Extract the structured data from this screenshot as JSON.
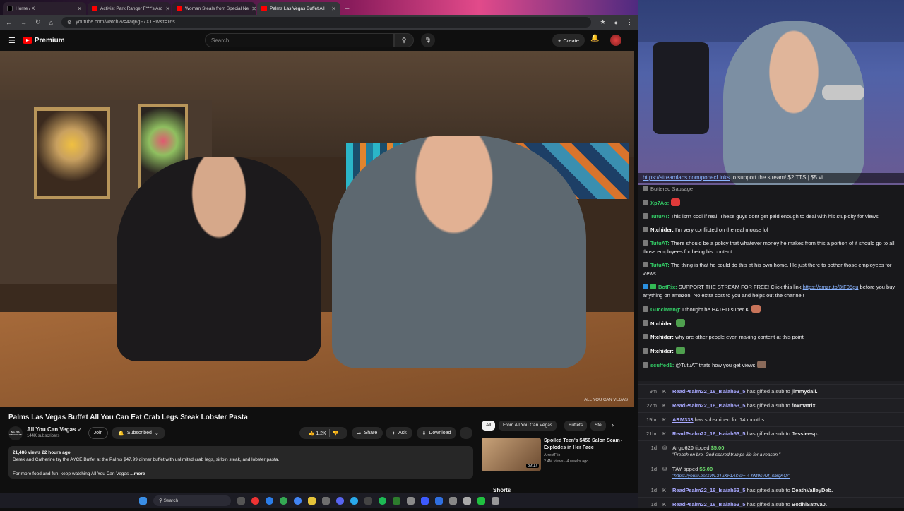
{
  "browser": {
    "tabs": [
      {
        "label": "Home / X",
        "active": false,
        "color": "#000000"
      },
      {
        "label": "Activist Park Ranger F***'s Aro",
        "active": false,
        "color": "#ff0000"
      },
      {
        "label": "Woman Steals from Special Ne",
        "active": false,
        "color": "#ff0000"
      },
      {
        "label": "Palms Las Vegas Buffet All",
        "active": true,
        "color": "#ff0000"
      }
    ],
    "url": "youtube.com/watch?v=4aq6gF7XTHw&t=16s"
  },
  "youtube": {
    "logo_label": "Premium",
    "search_placeholder": "Search",
    "create_label": "Create",
    "video_watermark": "ALL YOU CAN VEGAS",
    "video_title": "Palms Las Vegas Buffet All You Can Eat Crab Legs Steak Lobster Pasta",
    "channel_name": "All You Can Vegas",
    "channel_icon_text": "ALL YOU CAN VEGAS",
    "channel_subs": "144K subscribers",
    "join_label": "Join",
    "subscribed_label": "Subscribed",
    "like_count": "1.2K",
    "share_label": "Share",
    "ask_label": "Ask",
    "download_label": "Download",
    "description": {
      "meta": "21,486 views  22 hours ago",
      "line1": "Derek and Catherine try the AYCE Buffet at the Palms $47.99 dinner buffet with unlimited crab legs, sirloin steak, and lobster pasta.",
      "line2": "For more food and fun, keep watching All You Can Vegas",
      "more": "...more"
    },
    "chips": [
      "All",
      "From All You Can Vegas",
      "Buffets",
      "Ste"
    ],
    "suggested": {
      "title": "Spoiled Teen's $450 Salon Scam Explodes in Her Face",
      "channel": "ArrestFlix",
      "meta": "2.4M views · 4 weeks ago",
      "duration": "39:17"
    },
    "next_section": "Shorts"
  },
  "taskbar": {
    "search_placeholder": "Search"
  },
  "stream": {
    "ticker_link": "https://streamlabs.com/ponecLinks",
    "ticker_text": " to support the stream! $2 TTS | $5 vi..."
  },
  "chat": {
    "messages": [
      {
        "user": "",
        "text": "Buttered Sausage",
        "color": "#aaaaaa"
      },
      {
        "user": "Xp7Ao:",
        "text": "",
        "color": "#33cc66",
        "emote": "#e03a3a"
      },
      {
        "user": "TutuAT:",
        "text": "This isn't cool if real. These guys dont get paid enough to deal with his stupidity for views",
        "color": "#33cc66"
      },
      {
        "user": "Ntchider:",
        "text": "I'm very conflicted on the real mouse lol",
        "color": "#ffffff"
      },
      {
        "user": "TutuAT:",
        "text": "There should be a policy that whatever money he makes from this a portion of it should go to all those employees for being his content",
        "color": "#33cc66"
      },
      {
        "user": "TutuAT:",
        "text": "The thing is that he could do this at his own home. He just there to bother those employees for views",
        "color": "#33cc66"
      },
      {
        "user": "BotRix:",
        "text": "SUPPORT THE STREAM FOR FREE! Click this link ",
        "link": "https://amzn.to/3tF05gu",
        "text2": " before you buy anything on amazon. No extra cost to you and helps out the channel!",
        "color": "#33cc66"
      },
      {
        "user": "GucciMang:",
        "text": "I thought he HATED super K",
        "color": "#33cc66",
        "emote": "#c8745a"
      },
      {
        "user": "Ntchider:",
        "text": "",
        "color": "#ffffff",
        "emote": "#4fa04f"
      },
      {
        "user": "Ntchider:",
        "text": "why are other people even making content at this point",
        "color": "#ffffff"
      },
      {
        "user": "Ntchider:",
        "text": "",
        "color": "#ffffff",
        "emote": "#4fa04f"
      },
      {
        "user": "scuffed1:",
        "text": "@TutuAT thats how you get views",
        "color": "#33cc66",
        "emote": "#8a6a5a"
      }
    ]
  },
  "events": [
    {
      "time": "9m",
      "user": "ReadPsalm22_16_Isaiah53_5",
      "text": " has gifted a sub to ",
      "target": "jimmydali."
    },
    {
      "time": "27m",
      "user": "ReadPsalm22_16_Isaiah53_5",
      "text": " has gifted a sub to ",
      "target": "foxmatrix."
    },
    {
      "time": "19hr",
      "user": "ARM333",
      "text": " has subscribed for 14 months",
      "target": ""
    },
    {
      "time": "21hr",
      "user": "ReadPsalm22_16_Isaiah53_5",
      "text": " has gifted a sub to ",
      "target": "Jessieesp."
    },
    {
      "time": "1d",
      "user": "Argo620",
      "text": " tipped ",
      "amount": "$5.00",
      "quote": "\"Preach on bro. God spared trumps life for a reason.\""
    },
    {
      "time": "1d",
      "user": "TAY",
      "text": " tipped ",
      "amount": "$5.00",
      "quote_link": "\"https://youtu.be/XWL3TuXF1AI?si=-4-hM9syUf_i98gKQi\""
    },
    {
      "time": "1d",
      "user": "ReadPsalm22_16_Isaiah53_5",
      "text": " has gifted a sub to ",
      "target": "DeathValleyDeb."
    },
    {
      "time": "1d",
      "user": "ReadPsalm22_16_Isaiah53_5",
      "text": " has gifted a sub to ",
      "target": "BodhiSattva0."
    }
  ]
}
